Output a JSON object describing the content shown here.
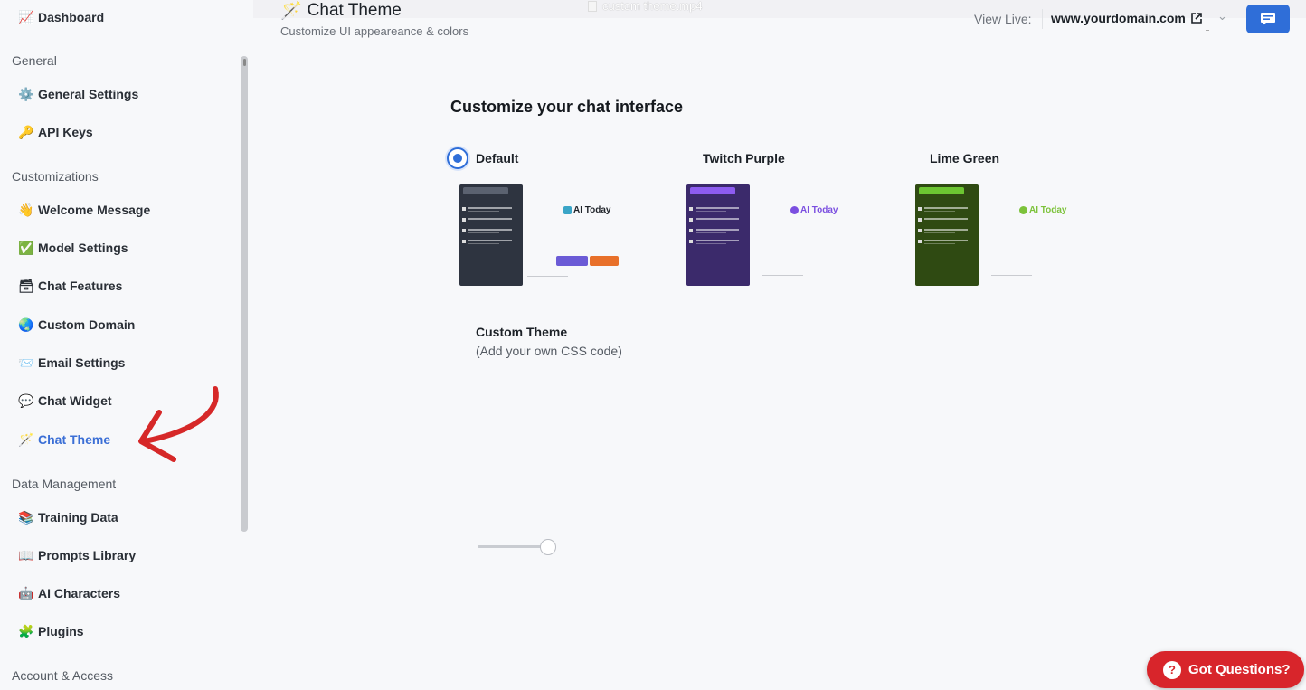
{
  "window": {
    "video_title": "custom theme.mp4"
  },
  "sidebar": {
    "items": [
      {
        "label": "Dashboard",
        "icon": "📈"
      },
      {
        "label": "General Settings",
        "icon": "⚙️"
      },
      {
        "label": "API Keys",
        "icon": "🔑"
      },
      {
        "label": "Welcome Message",
        "icon": "👋"
      },
      {
        "label": "Model Settings",
        "icon": "✅"
      },
      {
        "label": "Chat Features",
        "icon": "🗃"
      },
      {
        "label": "Custom Domain",
        "icon": "🌏"
      },
      {
        "label": "Email Settings",
        "icon": "📨"
      },
      {
        "label": "Chat Widget",
        "icon": "💬"
      },
      {
        "label": "Chat Theme",
        "icon": "🪄"
      },
      {
        "label": "Training Data",
        "icon": "📚"
      },
      {
        "label": "Prompts Library",
        "icon": "📖"
      },
      {
        "label": "AI Characters",
        "icon": "🤖"
      },
      {
        "label": "Plugins",
        "icon": "🧩"
      }
    ],
    "sections": {
      "general": "General",
      "customizations": "Customizations",
      "data_management": "Data Management",
      "account_access": "Account & Access"
    },
    "active": "Chat Theme"
  },
  "header": {
    "title": "Chat Theme",
    "title_icon": "🪄",
    "subtitle": "Customize UI appeareance & colors",
    "view_live_label": "View Live:",
    "domain": "www.yourdomain.com"
  },
  "content": {
    "section_title": "Customize your chat interface",
    "themes": [
      {
        "name": "Default",
        "selected": true,
        "panel_color": "#2e3440",
        "bar_color": "#5b6270",
        "accent": "#3aa5c7",
        "preview_title": "AI Today"
      },
      {
        "name": "Twitch Purple",
        "selected": false,
        "panel_color": "#3b2a6b",
        "bar_color": "#8d5cf0",
        "accent": "#7b4fe0",
        "preview_title": "AI Today"
      },
      {
        "name": "Lime Green",
        "selected": false,
        "panel_color": "#2f4a12",
        "bar_color": "#6cc531",
        "accent": "#7cc23a",
        "preview_title": "AI Today"
      }
    ],
    "custom_theme": {
      "name": "Custom Theme",
      "description": "(Add your own CSS code)",
      "selected": false
    }
  },
  "help_button": {
    "label": "Got Questions?",
    "icon": "?"
  },
  "colors": {
    "primary": "#2f6ed8",
    "help": "#d8252b",
    "annotation_arrow": "#d62828"
  }
}
